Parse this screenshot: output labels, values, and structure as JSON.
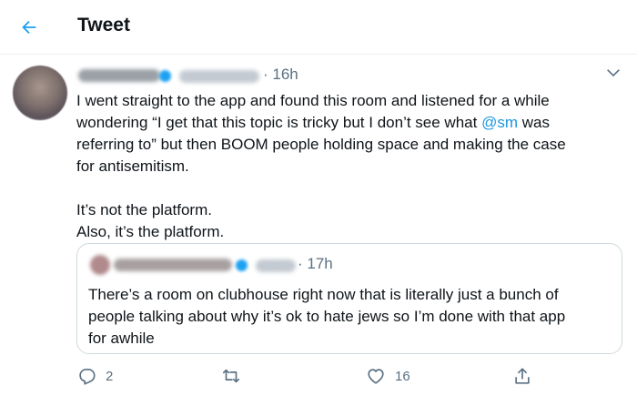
{
  "header": {
    "back_icon": "back-arrow-icon",
    "title": "Tweet"
  },
  "tweet": {
    "time": "· 16h",
    "lines": [
      "I went straight to the app and found this room and listened for a while",
      "wondering “I get that this topic is tricky but I don’t see what ",
      "@sm",
      " was",
      "referring to” but then BOOM people holding space and making the case",
      "for antisemitism.",
      "It’s not the platform.",
      "Also, it’s the platform."
    ],
    "colors": {
      "accent": "#1b95e0",
      "muted": "#5b7083",
      "border": "#cfd9de"
    }
  },
  "quote": {
    "time": "· 17h",
    "lines": [
      "There’s a room on clubhouse right now that is literally just a bunch of",
      "people talking about why it’s ok to hate jews so I’m done with that app",
      "for awhile"
    ]
  },
  "actions": {
    "reply": {
      "icon": "reply-icon",
      "count": "2"
    },
    "retweet": {
      "icon": "retweet-icon"
    },
    "like": {
      "icon": "like-icon",
      "count": "16"
    },
    "share": {
      "icon": "share-icon"
    }
  }
}
